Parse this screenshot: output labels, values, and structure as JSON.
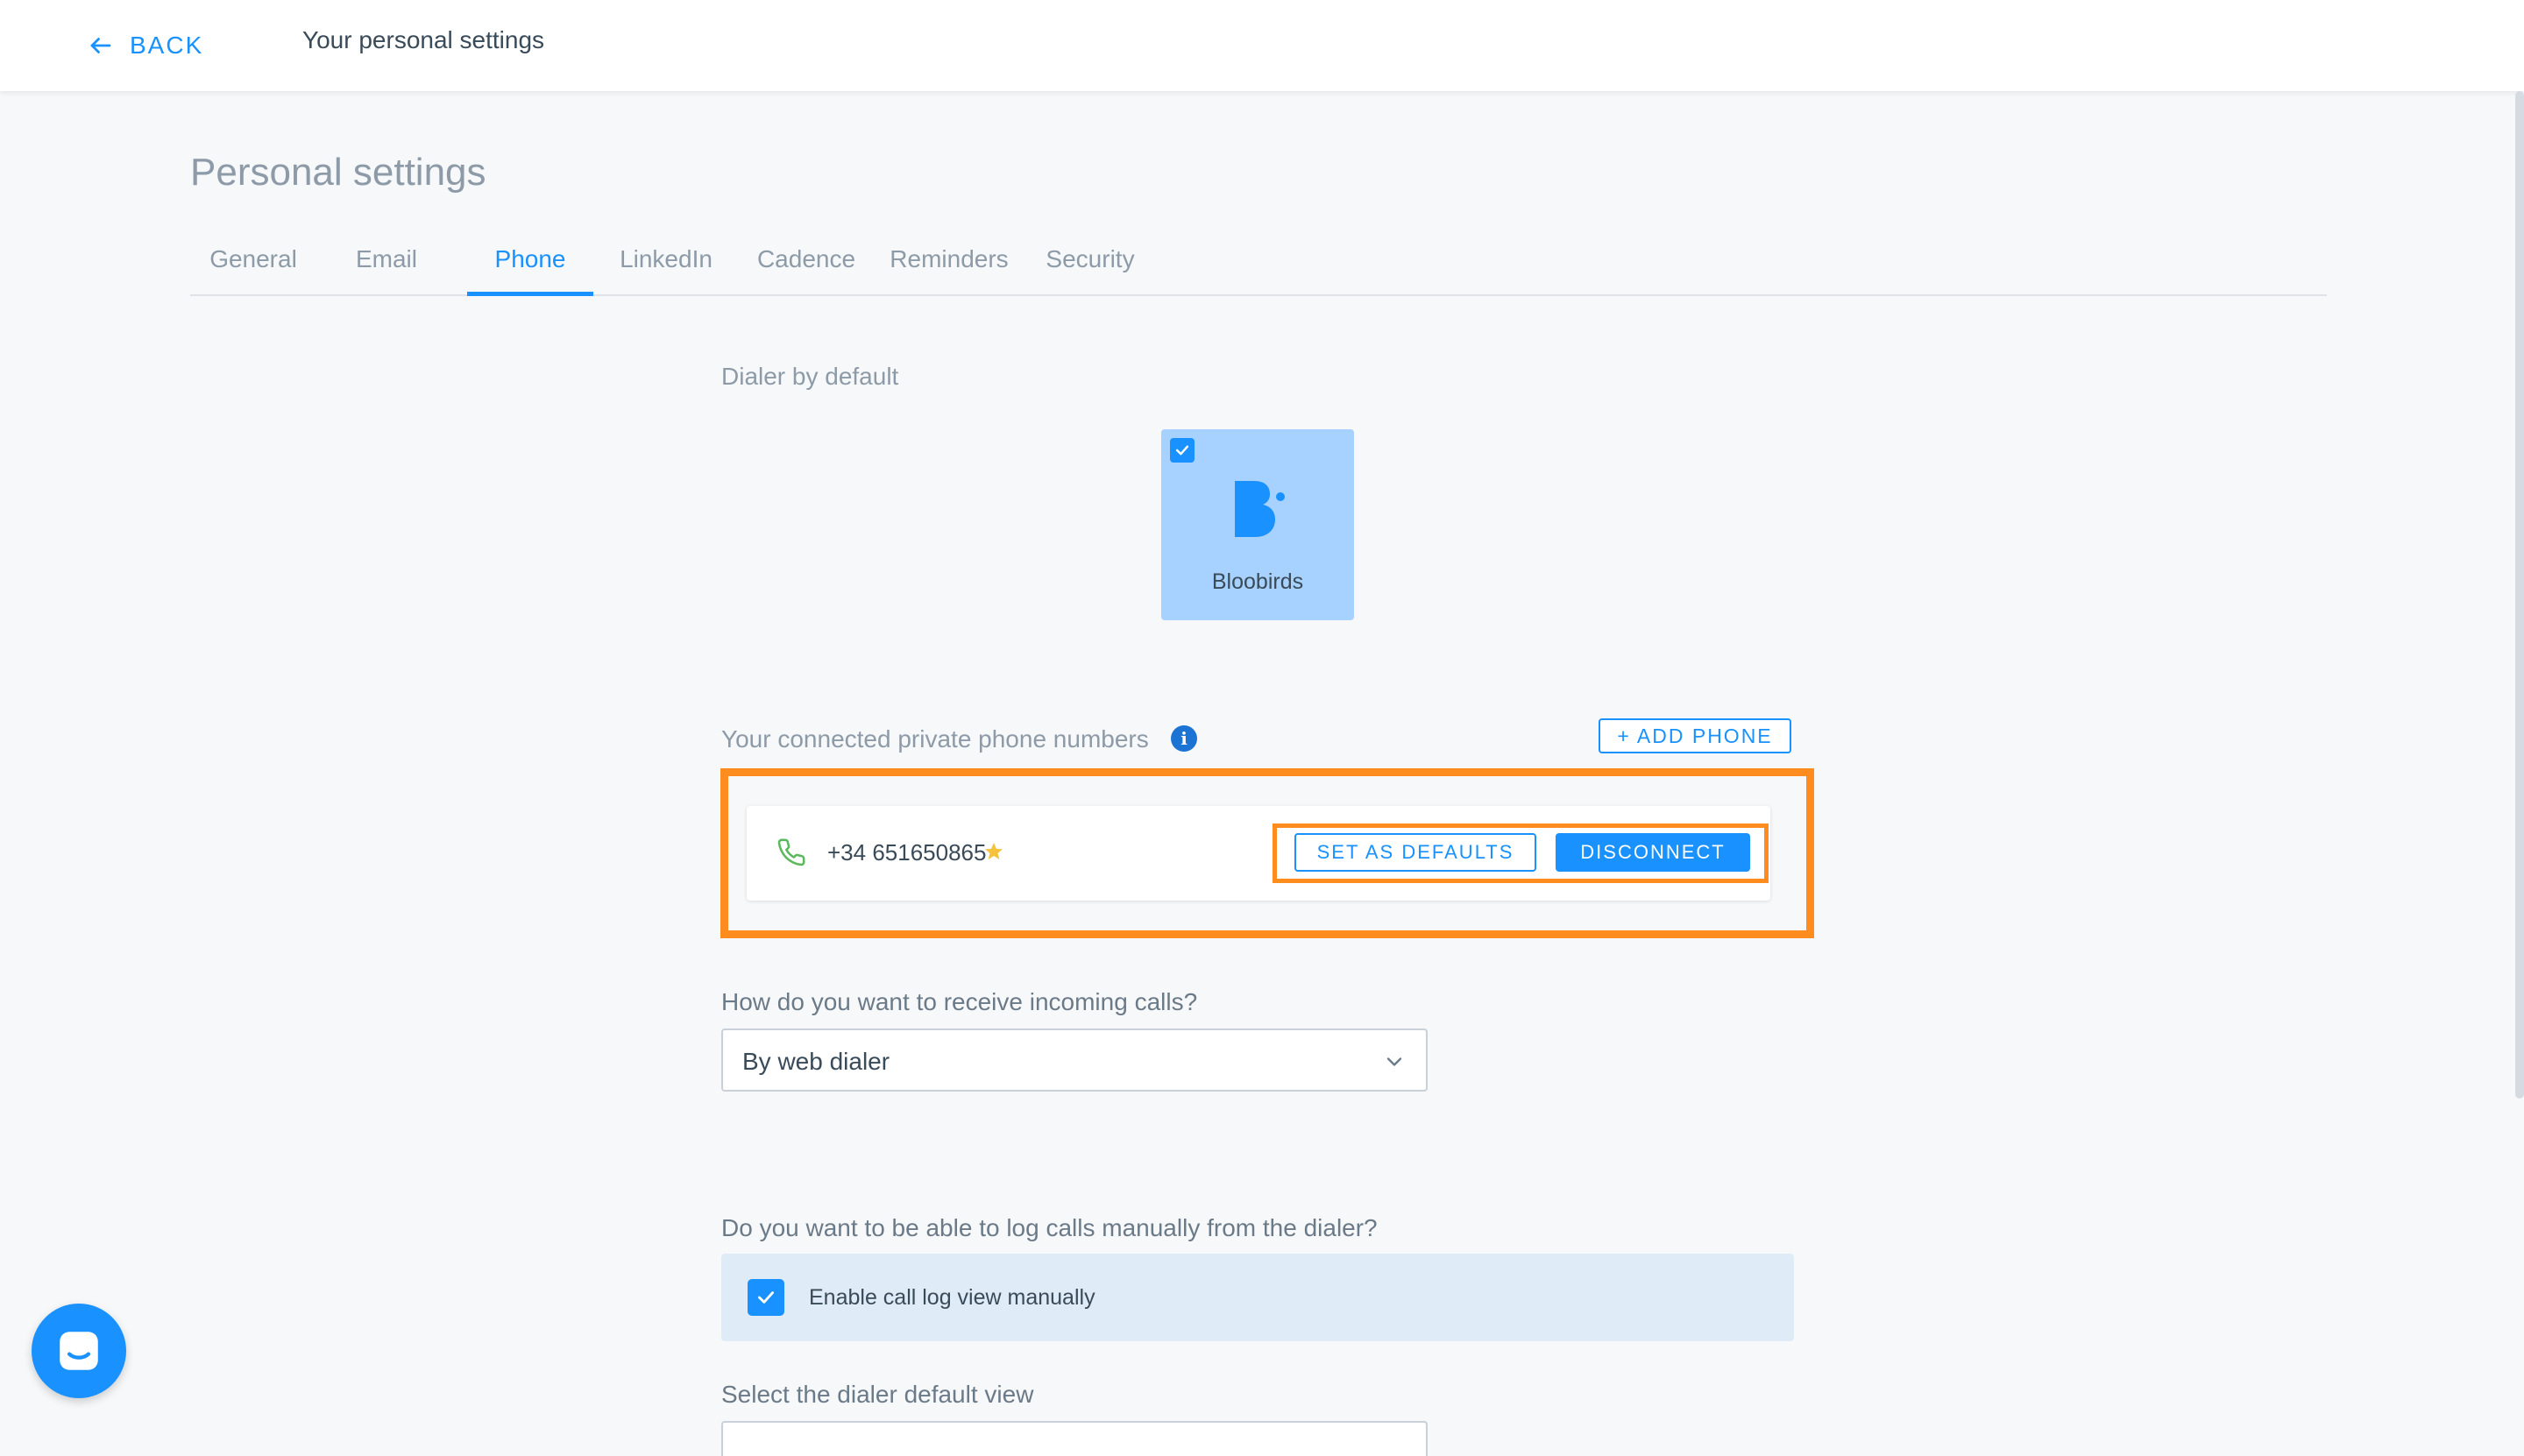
{
  "header": {
    "back_label": "BACK",
    "title": "Your personal settings"
  },
  "page": {
    "title": "Personal settings"
  },
  "tabs": [
    {
      "label": "General",
      "active": false
    },
    {
      "label": "Email",
      "active": false
    },
    {
      "label": "Phone",
      "active": true
    },
    {
      "label": "LinkedIn",
      "active": false
    },
    {
      "label": "Cadence",
      "active": false
    },
    {
      "label": "Reminders",
      "active": false
    },
    {
      "label": "Security",
      "active": false
    }
  ],
  "dialer": {
    "section_label": "Dialer by default",
    "option_name": "Bloobirds",
    "selected": true
  },
  "phones": {
    "section_label": "Your connected private phone numbers",
    "add_label": "+ ADD PHONE",
    "items": [
      {
        "number": "+34 651650865",
        "is_default": true,
        "set_default_label": "SET AS DEFAULTS",
        "disconnect_label": "DISCONNECT"
      }
    ]
  },
  "incoming": {
    "question": "How do you want to receive incoming calls?",
    "value": "By web dialer"
  },
  "call_log": {
    "question": "Do you want to be able to log calls manually from the dialer?",
    "option_label": "Enable call log view manually",
    "checked": true
  },
  "default_view": {
    "question": "Select the dialer default view"
  },
  "colors": {
    "primary": "#1991ff",
    "highlight": "#ff8c1e",
    "phone_icon": "#5cb85c",
    "star": "#f5c23d"
  },
  "icons": {
    "back": "arrow-left-icon",
    "dialer_check": "check-icon",
    "logo": "bloobirds-logo-icon",
    "info": "info-icon",
    "phone": "phone-icon",
    "star": "star-icon",
    "chevron": "chevron-down-icon",
    "chat": "chat-icon"
  }
}
